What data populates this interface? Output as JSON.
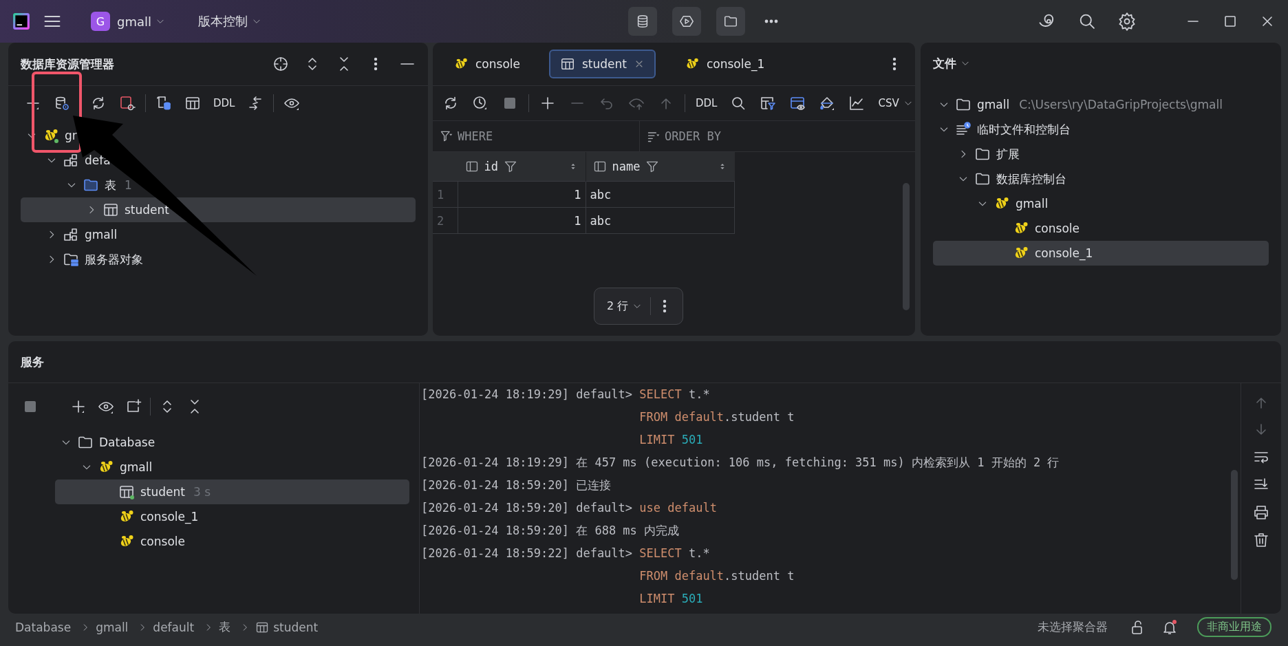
{
  "title_bar": {
    "project": {
      "initial": "G",
      "name": "gmall"
    },
    "vcs_menu": "版本控制"
  },
  "database_explorer": {
    "title": "数据库资源管理器",
    "toolbar_text": "DDL",
    "tree": [
      {
        "label": "gr",
        "kind": "datasource",
        "connected": true,
        "expanded": true,
        "selected": false,
        "children": [
          {
            "label": "defa",
            "kind": "schema",
            "expanded": true,
            "selected": false,
            "children": [
              {
                "label": "表",
                "kind": "db-folder",
                "count": "1",
                "expanded": true,
                "selected": false,
                "children": [
                  {
                    "label": "student",
                    "kind": "table",
                    "expanded": false,
                    "selected": true
                  }
                ]
              }
            ]
          },
          {
            "label": "gmall",
            "kind": "schema",
            "expanded": false,
            "selected": false
          },
          {
            "label": "服务器对象",
            "kind": "server-folder",
            "expanded": false,
            "selected": false
          }
        ]
      }
    ]
  },
  "editor": {
    "tabs": [
      {
        "label": "console",
        "kind": "console",
        "selected": false
      },
      {
        "label": "student",
        "kind": "table",
        "selected": true
      },
      {
        "label": "console_1",
        "kind": "console",
        "selected": false
      }
    ],
    "toolbar": {
      "ddl": "DDL",
      "export_format": "CSV"
    },
    "filters": {
      "where": "WHERE",
      "order_by": "ORDER BY"
    },
    "table": {
      "columns": [
        "id",
        "name"
      ],
      "rows": [
        {
          "number": "1",
          "cells": [
            "1",
            "abc"
          ]
        },
        {
          "number": "2",
          "cells": [
            "1",
            "abc"
          ]
        }
      ]
    },
    "row_count": "2 行"
  },
  "files": {
    "title": "文件",
    "tree": [
      {
        "label": "gmall",
        "kind": "folder",
        "path": "C:\\Users\\ry\\DataGripProjects\\gmall",
        "expanded": true,
        "selected": false
      },
      {
        "label": "临时文件和控制台",
        "kind": "scratches",
        "expanded": true,
        "selected": false,
        "children": [
          {
            "label": "扩展",
            "kind": "folder",
            "expanded": false,
            "selected": false
          },
          {
            "label": "数据库控制台",
            "kind": "folder",
            "expanded": true,
            "selected": false,
            "children": [
              {
                "label": "gmall",
                "kind": "console",
                "expanded": true,
                "selected": false,
                "children": [
                  {
                    "label": "console",
                    "kind": "console",
                    "selected": false
                  },
                  {
                    "label": "console_1",
                    "kind": "console",
                    "selected": true
                  }
                ]
              }
            ]
          }
        ]
      }
    ]
  },
  "services": {
    "title": "服务",
    "tree": [
      {
        "label": "Database",
        "kind": "folder",
        "expanded": true,
        "selected": false,
        "children": [
          {
            "label": "gmall",
            "kind": "console",
            "expanded": true,
            "selected": false,
            "children": [
              {
                "label": "student",
                "kind": "table",
                "running": true,
                "hint": "3 s",
                "selected": true
              },
              {
                "label": "console_1",
                "kind": "console",
                "selected": false
              },
              {
                "label": "console",
                "kind": "console",
                "selected": false
              }
            ]
          }
        ]
      }
    ],
    "log": [
      {
        "time": "[2026-01-24 18:19:29]",
        "parts": [
          {
            "kind": "plain",
            "text": " default> "
          },
          {
            "kind": "keyword",
            "text": "SELECT"
          },
          {
            "kind": "plain",
            "text": " t.*"
          }
        ]
      },
      {
        "parts": [
          {
            "kind": "keyword",
            "text": "FROM default"
          },
          {
            "kind": "plain",
            "text": ".student t"
          }
        ]
      },
      {
        "parts": [
          {
            "kind": "keyword",
            "text": "LIMIT "
          },
          {
            "kind": "number",
            "text": "501"
          }
        ]
      },
      {
        "time": "[2026-01-24 18:19:29]",
        "parts": [
          {
            "kind": "plain",
            "text": " 在 457 ms (execution: 106 ms, fetching: 351 ms) 内检索到从 1 开始的 2 行"
          }
        ]
      },
      {
        "time": "[2026-01-24 18:59:20]",
        "parts": [
          {
            "kind": "plain",
            "text": " 已连接"
          }
        ]
      },
      {
        "time": "[2026-01-24 18:59:20]",
        "parts": [
          {
            "kind": "plain",
            "text": " default> "
          },
          {
            "kind": "keyword",
            "text": "use default"
          }
        ]
      },
      {
        "time": "[2026-01-24 18:59:20]",
        "parts": [
          {
            "kind": "plain",
            "text": " 在 688 ms 内完成"
          }
        ]
      },
      {
        "time": "[2026-01-24 18:59:22]",
        "parts": [
          {
            "kind": "plain",
            "text": " default> "
          },
          {
            "kind": "keyword",
            "text": "SELECT"
          },
          {
            "kind": "plain",
            "text": " t.*"
          }
        ]
      },
      {
        "parts": [
          {
            "kind": "keyword",
            "text": "FROM default"
          },
          {
            "kind": "plain",
            "text": ".student t"
          }
        ]
      },
      {
        "parts": [
          {
            "kind": "keyword",
            "text": "LIMIT "
          },
          {
            "kind": "number",
            "text": "501"
          }
        ]
      }
    ]
  },
  "status_bar": {
    "breadcrumbs": [
      {
        "label": "Database",
        "kind": "text"
      },
      {
        "label": "gmall",
        "kind": "text"
      },
      {
        "label": "default",
        "kind": "text"
      },
      {
        "label": "表",
        "kind": "text"
      },
      {
        "label": "student",
        "kind": "table"
      }
    ],
    "aggregator": "未选择聚合器",
    "has_notifications": true,
    "license": "非商业用途"
  },
  "annotations": [
    {
      "kind": "box"
    },
    {
      "kind": "arrow"
    }
  ]
}
